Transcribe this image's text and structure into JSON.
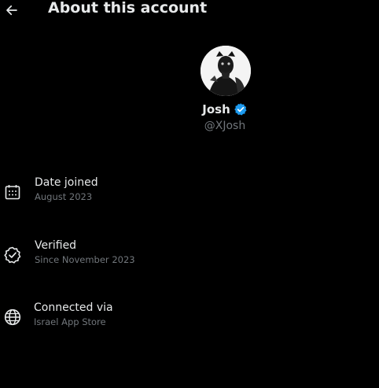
{
  "header": {
    "back_icon": "arrow-left-icon",
    "title": "About this account"
  },
  "profile": {
    "display_name": "Josh",
    "verified_icon": "verified-badge-icon",
    "verified_color": "#1d9bf0",
    "handle": "@XJosh"
  },
  "details": [
    {
      "icon": "calendar-icon",
      "title": "Date joined",
      "subtitle": "August 2023"
    },
    {
      "icon": "verified-check-icon",
      "title": "Verified",
      "subtitle": "Since November 2023"
    },
    {
      "icon": "globe-icon",
      "title": "Connected via",
      "subtitle": "Israel App Store"
    }
  ]
}
